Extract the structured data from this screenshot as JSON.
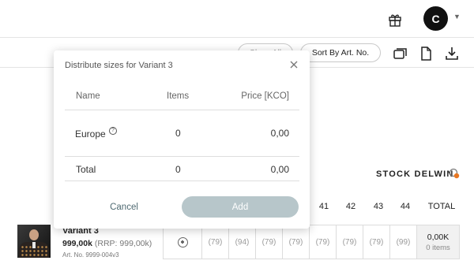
{
  "header": {
    "avatar_initial": "C",
    "gift_icon": "gift-icon",
    "dropdown_icon": "chevron-down-icon"
  },
  "toolbar": {
    "hidden_pill_label": "Show All",
    "sort_label": "Sort By Art. No.",
    "icons": [
      "duplicate-icon",
      "document-icon",
      "download-icon"
    ]
  },
  "stock": {
    "label": "STOCK DELWIN",
    "status_color": "#e87722"
  },
  "size_headers": [
    "41",
    "42",
    "43",
    "44",
    "TOTAL"
  ],
  "product": {
    "name": "Variant 3",
    "price": "999,00k",
    "rrp": "(RRP: 999,00k)",
    "article": "Art. No. 9999-004v3",
    "cells": [
      "(79)",
      "(94)",
      "(79)",
      "(79)",
      "(79)",
      "(79)",
      "(79)",
      "(99)"
    ],
    "total_value": "0,00K",
    "total_items": "0 items"
  },
  "modal": {
    "title": "Distribute sizes for Variant 3",
    "columns": {
      "name": "Name",
      "items": "Items",
      "price": "Price [KCO]"
    },
    "rows": [
      {
        "name": "Europe",
        "items": "0",
        "price": "0,00"
      }
    ],
    "total": {
      "name": "Total",
      "items": "0",
      "price": "0,00"
    },
    "cancel_label": "Cancel",
    "add_label": "Add"
  }
}
